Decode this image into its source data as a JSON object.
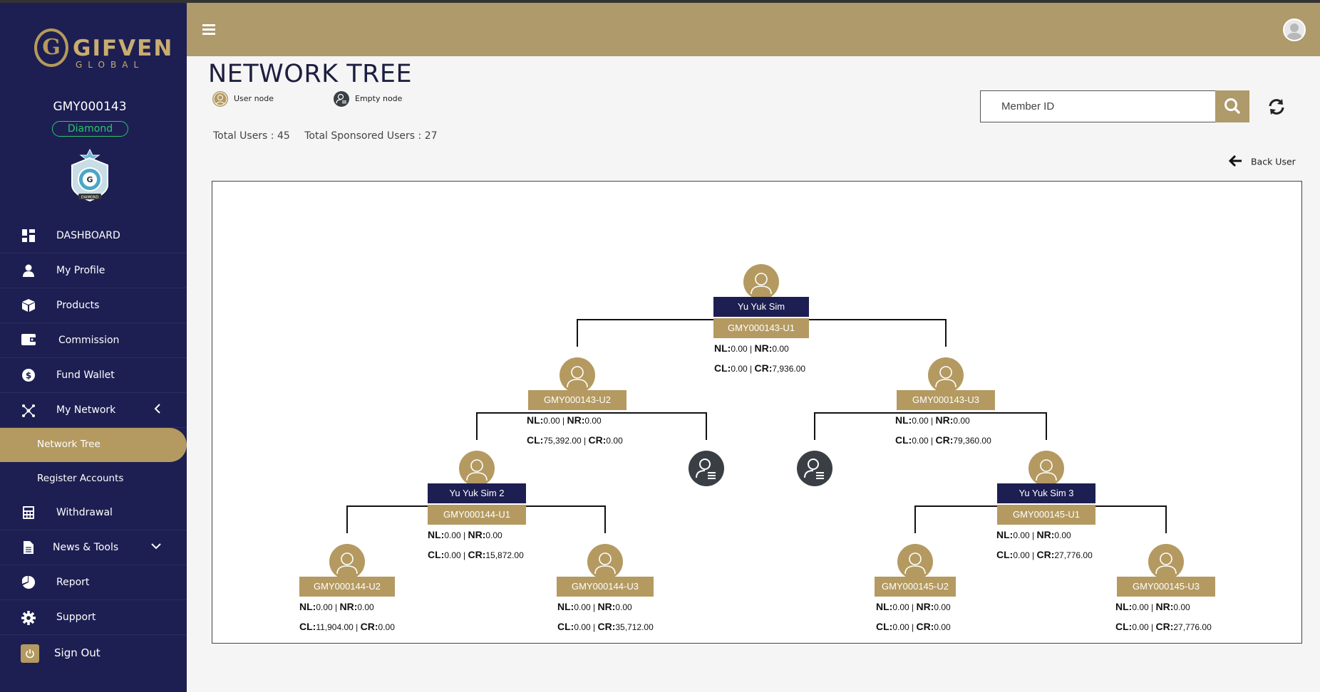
{
  "sidebar": {
    "logo_text": "GIFVEN",
    "logo_sub": "GLOBAL",
    "username": "GMY000143",
    "rank": "Diamond",
    "badge_text": "DIAMOND",
    "items": [
      {
        "label": "DASHBOARD",
        "icon": "dashboard-icon"
      },
      {
        "label": "My Profile",
        "icon": "user-icon"
      },
      {
        "label": "Products",
        "icon": "box-icon"
      },
      {
        "label": "Commission",
        "icon": "wallet-icon"
      },
      {
        "label": "Fund Wallet",
        "icon": "dollar-icon"
      },
      {
        "label": "My Network",
        "icon": "network-icon"
      },
      {
        "label": "Network Tree"
      },
      {
        "label": "Register Accounts"
      },
      {
        "label": "Withdrawal",
        "icon": "calculator-icon"
      },
      {
        "label": "News & Tools",
        "icon": "document-icon"
      },
      {
        "label": "Report",
        "icon": "pie-chart-icon"
      },
      {
        "label": "Support",
        "icon": "gear-icon"
      },
      {
        "label": "Sign Out",
        "icon": "power-icon"
      }
    ]
  },
  "page": {
    "title": "NETWORK TREE",
    "legend_user": "User node",
    "legend_empty": "Empty node",
    "total_users": "Total Users : 45",
    "total_sponsored": "Total Sponsored Users : 27",
    "search_placeholder": "Member ID",
    "back_user": "Back User"
  },
  "tree": {
    "root": {
      "name": "Yu Yuk Sim",
      "id": "GMY000143-U1",
      "nl": "0.00",
      "nr": "0.00",
      "cl": "0.00",
      "cr": "7,936.00"
    },
    "l1_left": {
      "id": "GMY000143-U2",
      "nl": "0.00",
      "nr": "0.00",
      "cl": "75,392.00",
      "cr": "0.00"
    },
    "l1_right": {
      "id": "GMY000143-U3",
      "nl": "0.00",
      "nr": "0.00",
      "cl": "0.00",
      "cr": "79,360.00"
    },
    "l2_a": {
      "name": "Yu Yuk Sim 2",
      "id": "GMY000144-U1",
      "nl": "0.00",
      "nr": "0.00",
      "cl": "0.00",
      "cr": "15,872.00"
    },
    "l2_d": {
      "name": "Yu Yuk Sim 3",
      "id": "GMY000145-U1",
      "nl": "0.00",
      "nr": "0.00",
      "cl": "0.00",
      "cr": "27,776.00"
    },
    "l3_a": {
      "id": "GMY000144-U2",
      "nl": "0.00",
      "nr": "0.00",
      "cl": "11,904.00",
      "cr": "0.00"
    },
    "l3_b": {
      "id": "GMY000144-U3",
      "nl": "0.00",
      "nr": "0.00",
      "cl": "0.00",
      "cr": "35,712.00"
    },
    "l3_c": {
      "id": "GMY000145-U2",
      "nl": "0.00",
      "nr": "0.00",
      "cl": "0.00",
      "cr": "0.00"
    },
    "l3_d": {
      "id": "GMY000145-U3",
      "nl": "0.00",
      "nr": "0.00",
      "cl": "0.00",
      "cr": "27,776.00"
    },
    "labels": {
      "nl": "NL:",
      "nr": "NR:",
      "cl": "CL:",
      "cr": "CR:"
    }
  },
  "colors": {
    "gold": "#b49a61",
    "navy": "#1d1f52",
    "empty_node": "#3a3f45"
  }
}
